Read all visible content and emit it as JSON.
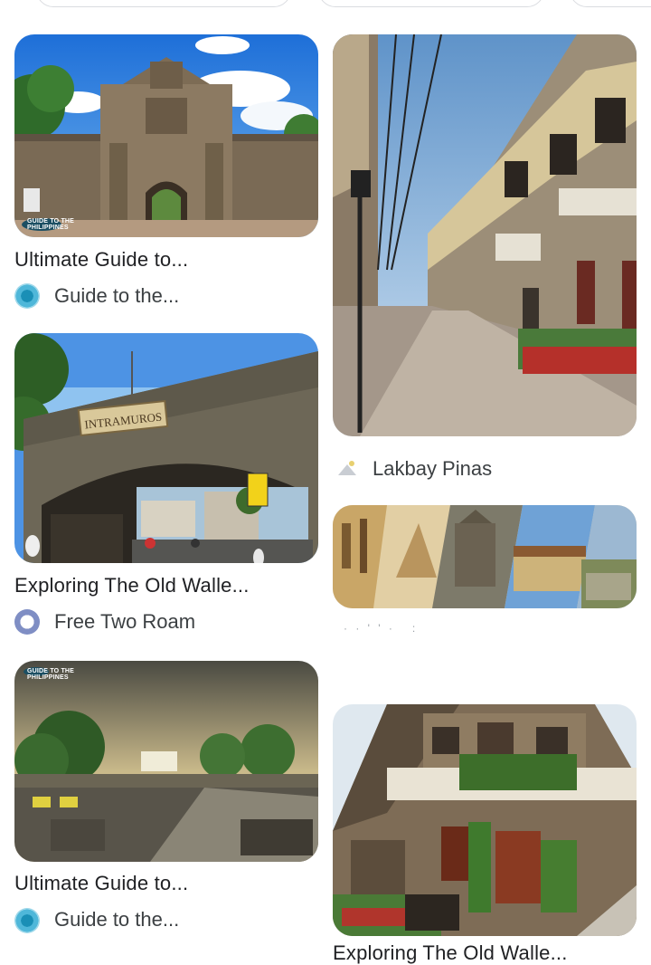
{
  "filter_chips": [
    "",
    "",
    ""
  ],
  "results": [
    {
      "image_alt": "Fort Santiago gate",
      "badge": "GUIDE TO THE PHILIPPINES",
      "title": "Ultimate Guide to...",
      "source": "Guide to the..."
    },
    {
      "image_alt": "Intramuros street with old houses",
      "title": "",
      "source": "Lakbay Pinas"
    },
    {
      "image_alt": "Intramuros arch gate",
      "sign": "INTRAMUROS",
      "title": "Exploring The Old Walle...",
      "source": "Free Two Roam"
    },
    {
      "image_alt": "Collage of Intramuros sights",
      "caption": "Pamana de Intramuros",
      "title": "",
      "source": ""
    },
    {
      "image_alt": "Intramuros walls at sunset",
      "badge": "GUIDE TO THE PHILIPPINES",
      "title": "Ultimate Guide to...",
      "source": "Guide to the..."
    },
    {
      "image_alt": "Old colonial house with vines",
      "title": "Exploring The Old Walle...",
      "source": ""
    }
  ],
  "colors": {
    "card_radius_bg": "#ffffff",
    "chip_border": "#dadce0",
    "guide_icon": "#1a8fb6",
    "roam_icon": "#7f8ec4"
  }
}
